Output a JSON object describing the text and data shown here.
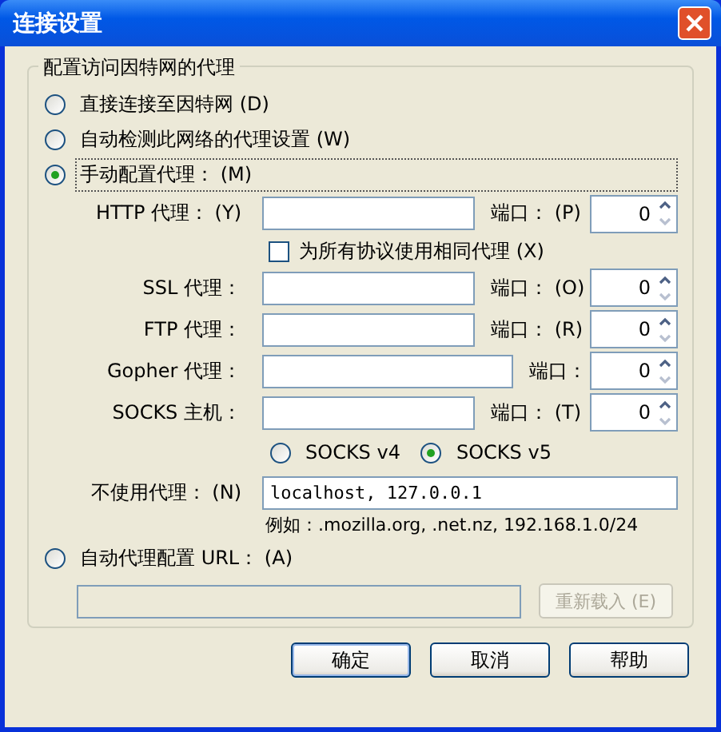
{
  "window": {
    "title": "连接设置"
  },
  "group": {
    "legend": "配置访问因特网的代理"
  },
  "direct": {
    "label": "直接连接至因特网 (D)",
    "selected": false
  },
  "auto_detect": {
    "label": "自动检测此网络的代理设置 (W)",
    "selected": false
  },
  "manual": {
    "label": "手动配置代理： (M)",
    "selected": true,
    "focused": true
  },
  "proxies": [
    {
      "label": "HTTP 代理： (Y)",
      "kind": "normal",
      "port_label": "端口： (P)",
      "port": "0"
    },
    {
      "label": "SSL 代理：",
      "kind": "normal",
      "port_label": "端口： (O)",
      "port": "0"
    },
    {
      "label": "FTP 代理：",
      "kind": "normal",
      "port_label": "端口： (R)",
      "port": "0"
    },
    {
      "label": "Gopher 代理：",
      "kind": "wide",
      "port_label": "端口：",
      "port": "0"
    },
    {
      "label": "SOCKS 主机：",
      "kind": "normal",
      "port_label": "端口： (T)",
      "port": "0"
    }
  ],
  "same_proxy": {
    "label": "为所有协议使用相同代理 (X)",
    "checked": false
  },
  "socks_versions": [
    {
      "label": "SOCKS v4",
      "selected": false
    },
    {
      "label": "SOCKS v5",
      "selected": true
    }
  ],
  "no_proxy": {
    "label": "不使用代理： (N)",
    "value": "localhost, 127.0.0.1",
    "hint": "例如：.mozilla.org, .net.nz, 192.168.1.0/24"
  },
  "auto_config": {
    "label": "自动代理配置 URL： (A)",
    "selected": false,
    "disabled": true,
    "reload_button": "重新载入 (E)"
  },
  "buttons": [
    {
      "label": "确定",
      "default": true
    },
    {
      "label": "取消",
      "default": false
    },
    {
      "label": "帮助",
      "default": false
    }
  ]
}
